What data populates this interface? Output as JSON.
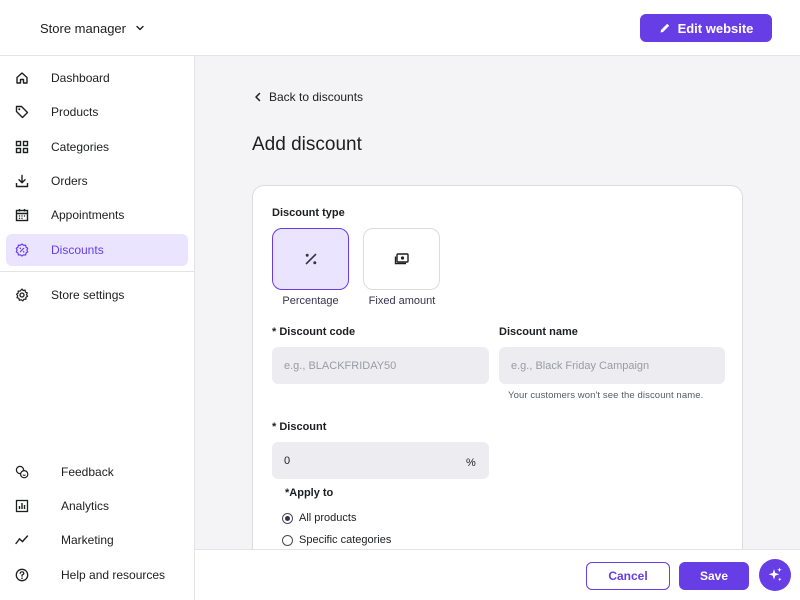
{
  "header": {
    "store_label": "Store manager",
    "edit_label": "Edit website"
  },
  "sidebar": {
    "items": [
      {
        "label": "Dashboard",
        "icon": "home-icon"
      },
      {
        "label": "Products",
        "icon": "tag-icon"
      },
      {
        "label": "Categories",
        "icon": "grid-icon"
      },
      {
        "label": "Orders",
        "icon": "download-icon"
      },
      {
        "label": "Appointments",
        "icon": "calendar-icon"
      },
      {
        "label": "Discounts",
        "icon": "discount-badge-icon",
        "active": true
      },
      {
        "label": "Store settings",
        "icon": "gear-icon"
      }
    ],
    "lower_items": [
      {
        "label": "Feedback",
        "icon": "feedback-icon"
      },
      {
        "label": "Analytics",
        "icon": "analytics-icon"
      },
      {
        "label": "Marketing",
        "icon": "marketing-icon"
      },
      {
        "label": "Help and resources",
        "icon": "help-icon"
      }
    ]
  },
  "main": {
    "back_label": "Back to discounts",
    "title": "Add discount",
    "form": {
      "discount_type_label": "Discount type",
      "types": [
        {
          "label": "Percentage",
          "selected": true
        },
        {
          "label": "Fixed amount",
          "selected": false
        }
      ],
      "code_label": "* Discount code",
      "code_placeholder": "e.g., BLACKFRIDAY50",
      "code_value": "",
      "name_label": "Discount name",
      "name_placeholder": "e.g., Black Friday Campaign",
      "name_value": "",
      "name_helper": "Your customers won't see the discount name.",
      "discount_label": "* Discount",
      "discount_value": "0",
      "discount_suffix": "%",
      "apply_to_label": "*Apply to",
      "apply_options": [
        {
          "label": "All products",
          "checked": true
        },
        {
          "label": "Specific categories",
          "checked": false
        }
      ]
    }
  },
  "footer": {
    "cancel_label": "Cancel",
    "save_label": "Save"
  },
  "colors": {
    "accent": "#673de6",
    "accent_light": "#ebe4ff",
    "background": "#f4f4f6",
    "input_bg": "#ededf1"
  }
}
